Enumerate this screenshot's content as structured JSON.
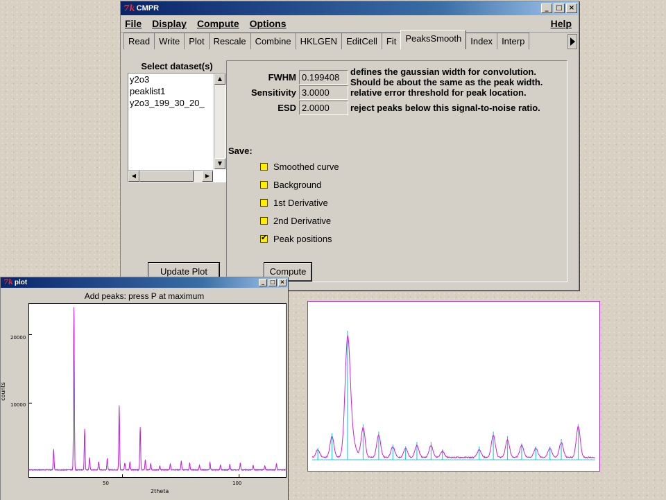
{
  "cmpr_window": {
    "title": "CMPR",
    "app_icon_glyph": "7k",
    "controls": [
      "_",
      "□",
      "×"
    ],
    "menus": [
      "File",
      "Display",
      "Compute",
      "Options"
    ],
    "help_label": "Help",
    "tabs": [
      "Read",
      "Write",
      "Plot",
      "Rescale",
      "Combine",
      "HKLGEN",
      "EditCell",
      "Fit",
      "PeaksSmooth",
      "Index",
      "Interp"
    ],
    "active_tab": "PeaksSmooth",
    "dataset_title": "Select dataset(s)",
    "datasets": [
      "y2o3",
      "peaklist1",
      "y2o3_199_30_20_"
    ],
    "update_plot_label": "Update Plot",
    "params": [
      {
        "label": "FWHM",
        "value": "0.199408",
        "desc_line1": "defines the gaussian width for convolution.",
        "desc_line2": "Should be about the same as the peak width."
      },
      {
        "label": "Sensitivity",
        "value": "3.0000",
        "desc_line1": "relative error threshold for peak location.",
        "desc_line2": ""
      },
      {
        "label": "ESD",
        "value": "2.0000",
        "desc_line1": "reject peaks below this signal-to-noise ratio.",
        "desc_line2": ""
      }
    ],
    "save_label": "Save:",
    "save_options": [
      {
        "label": "Smoothed curve",
        "checked": false
      },
      {
        "label": "Background",
        "checked": false
      },
      {
        "label": "1st Derivative",
        "checked": false
      },
      {
        "label": "2nd Derivative",
        "checked": false
      },
      {
        "label": "Peak positions",
        "checked": true
      }
    ],
    "compute_label": "Compute"
  },
  "plot_window": {
    "title": "plot",
    "app_icon_glyph": "7k",
    "controls": [
      "_",
      "□",
      "×"
    ],
    "header": "Add peaks: press P at maximum"
  },
  "colors": {
    "obs_line": "#d020d0",
    "calc_line": "#4a70f0",
    "peak_marker": "#30c8e0",
    "checkbox_fill": "#ffee00"
  },
  "chart_data": [
    {
      "type": "line",
      "title": "Add peaks: press P at maximum",
      "xlabel": "2theta",
      "ylabel": "counts",
      "xlim": [
        10,
        120
      ],
      "ylim": [
        -800,
        24500
      ],
      "x_ticks": [
        50,
        100
      ],
      "y_ticks": [
        10000,
        20000
      ],
      "grid": false,
      "baseline": 200,
      "peaks": [
        {
          "x": 20.5,
          "y": 3000
        },
        {
          "x": 29.2,
          "y": 23800
        },
        {
          "x": 33.8,
          "y": 6000
        },
        {
          "x": 35.9,
          "y": 1800
        },
        {
          "x": 39.8,
          "y": 1200
        },
        {
          "x": 43.5,
          "y": 1700
        },
        {
          "x": 48.6,
          "y": 9400
        },
        {
          "x": 51.0,
          "y": 1000
        },
        {
          "x": 53.2,
          "y": 1200
        },
        {
          "x": 57.6,
          "y": 6200
        },
        {
          "x": 59.8,
          "y": 1500
        },
        {
          "x": 62.1,
          "y": 900
        },
        {
          "x": 66.0,
          "y": 600
        },
        {
          "x": 70.5,
          "y": 900
        },
        {
          "x": 75.2,
          "y": 1300
        },
        {
          "x": 78.8,
          "y": 1000
        },
        {
          "x": 83.0,
          "y": 700
        },
        {
          "x": 87.5,
          "y": 1100
        },
        {
          "x": 92.0,
          "y": 700
        },
        {
          "x": 96.0,
          "y": 800
        },
        {
          "x": 100.5,
          "y": 1000
        },
        {
          "x": 106.0,
          "y": 700
        },
        {
          "x": 111.0,
          "y": 600
        },
        {
          "x": 116.0,
          "y": 900
        }
      ]
    },
    {
      "type": "line",
      "title": "",
      "xlabel": "",
      "ylabel": "",
      "xlim": [
        0,
        100
      ],
      "ylim": [
        0,
        100
      ],
      "smooth_peaks": [
        {
          "x": 2,
          "y": 5
        },
        {
          "x": 7,
          "y": 14
        },
        {
          "x": 12.5,
          "y": 72
        },
        {
          "x": 18,
          "y": 20
        },
        {
          "x": 23.5,
          "y": 15
        },
        {
          "x": 28.5,
          "y": 7
        },
        {
          "x": 33,
          "y": 6
        },
        {
          "x": 37,
          "y": 8
        },
        {
          "x": 42,
          "y": 8
        },
        {
          "x": 46,
          "y": 4
        },
        {
          "x": 59,
          "y": 5
        },
        {
          "x": 64,
          "y": 15
        },
        {
          "x": 69,
          "y": 12
        },
        {
          "x": 74,
          "y": 8
        },
        {
          "x": 79,
          "y": 6
        },
        {
          "x": 84,
          "y": 6
        },
        {
          "x": 88,
          "y": 10
        },
        {
          "x": 94,
          "y": 21
        }
      ],
      "marker_peaks": [
        {
          "x": 2,
          "y": 8
        },
        {
          "x": 7,
          "y": 18
        },
        {
          "x": 12.5,
          "y": 87
        },
        {
          "x": 18,
          "y": 24
        },
        {
          "x": 23.5,
          "y": 19
        },
        {
          "x": 28.5,
          "y": 10
        },
        {
          "x": 33,
          "y": 9
        },
        {
          "x": 37,
          "y": 12
        },
        {
          "x": 42,
          "y": 12
        },
        {
          "x": 46,
          "y": 7
        },
        {
          "x": 59,
          "y": 9
        },
        {
          "x": 64,
          "y": 19
        },
        {
          "x": 69,
          "y": 16
        },
        {
          "x": 74,
          "y": 11
        },
        {
          "x": 79,
          "y": 9
        },
        {
          "x": 84,
          "y": 9
        },
        {
          "x": 88,
          "y": 14
        },
        {
          "x": 94,
          "y": 24
        }
      ]
    }
  ]
}
